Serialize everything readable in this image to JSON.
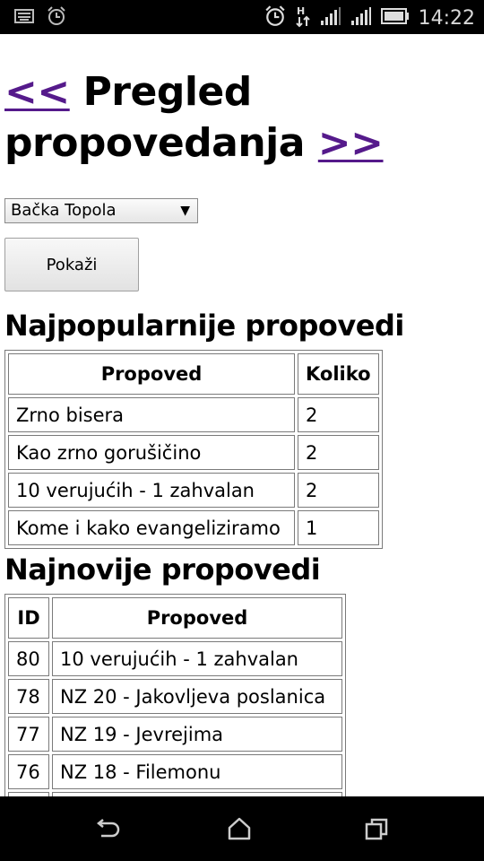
{
  "status_bar": {
    "time": "14:22",
    "icons": [
      "keyboard-icon",
      "alarm-icon",
      "alarm-clock-icon",
      "data-transfer-icon",
      "signal-icon",
      "signal-icon",
      "battery-icon"
    ]
  },
  "header": {
    "prev_link": "<<",
    "title": "Pregled propovedanja",
    "next_link": ">>"
  },
  "filter": {
    "location_selected": "Bačka Topola",
    "show_button": "Pokaži"
  },
  "popular": {
    "heading": "Najpopularnije propovedi",
    "columns": [
      "Propoved",
      "Koliko"
    ],
    "rows": [
      [
        "Zrno bisera",
        "2"
      ],
      [
        "Kao zrno gorušičino",
        "2"
      ],
      [
        "10 verujućih - 1 zahvalan",
        "2"
      ],
      [
        "Kome i kako evangeliziramo",
        "1"
      ]
    ]
  },
  "latest": {
    "heading": "Najnovije propovedi",
    "columns": [
      "ID",
      "Propoved"
    ],
    "rows": [
      [
        "80",
        "10 verujućih - 1 zahvalan"
      ],
      [
        "78",
        "NZ 20 - Jakovljeva poslanica"
      ],
      [
        "77",
        "NZ 19 - Jevrejima"
      ],
      [
        "76",
        "NZ 18 - Filemonu"
      ]
    ]
  },
  "nav_bar": {
    "icons": [
      "back-icon",
      "home-icon",
      "recent-apps-icon"
    ]
  },
  "colors": {
    "link": "#551a8b",
    "status_bar_bg": "#000000",
    "border": "#7a7a7a"
  }
}
